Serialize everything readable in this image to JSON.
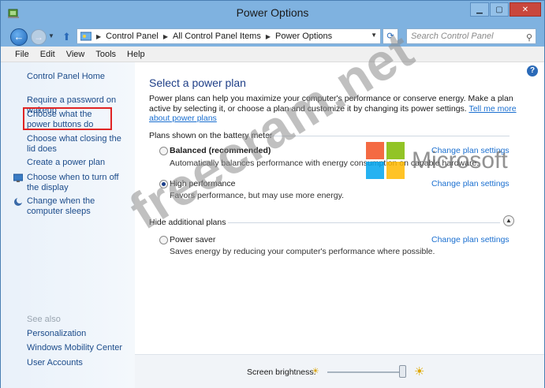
{
  "window": {
    "title": "Power Options",
    "controls": {
      "minimize": "▁",
      "maximize": "▢",
      "close": "✕"
    }
  },
  "nav": {
    "back": "←",
    "forward": "→",
    "breadcrumbs": [
      "Control Panel",
      "All Control Panel Items",
      "Power Options"
    ],
    "search_placeholder": "Search Control Panel"
  },
  "menu": [
    "File",
    "Edit",
    "View",
    "Tools",
    "Help"
  ],
  "sidebar": {
    "home": "Control Panel Home",
    "links": [
      "Require a password on wakeup",
      "Choose what the power buttons do",
      "Choose what closing the lid does",
      "Create a power plan",
      "Choose when to turn off the display",
      "Change when the computer sleeps"
    ],
    "see_also_label": "See also",
    "see_also": [
      "Personalization",
      "Windows Mobility Center",
      "User Accounts"
    ]
  },
  "main": {
    "heading": "Select a power plan",
    "intro": "Power plans can help you maximize your computer's performance or conserve energy. Make a plan active by selecting it, or choose a plan and customize it by changing its power settings.",
    "intro_link": "Tell me more about power plans",
    "battery_section": "Plans shown on the battery meter",
    "hidden_section": "Hide additional plans",
    "plans": [
      {
        "name": "Balanced (recommended)",
        "desc": "Automatically balances performance with energy consumption on capable hardware.",
        "selected": false
      },
      {
        "name": "High performance",
        "desc": "Favors performance, but may use more energy.",
        "selected": true
      },
      {
        "name": "Power saver",
        "desc": "Saves energy by reducing your computer's performance where possible.",
        "selected": false
      }
    ],
    "change_link": "Change plan settings",
    "brightness_label": "Screen brightness:",
    "brightness_value": 0.95
  },
  "watermark": {
    "text": "freecram.net",
    "brand": "Microsoft"
  },
  "colors": {
    "link": "#1a6fd0",
    "heading": "#1e3e87",
    "highlight": "#e02424",
    "titlebar": "#7fb2e0"
  }
}
